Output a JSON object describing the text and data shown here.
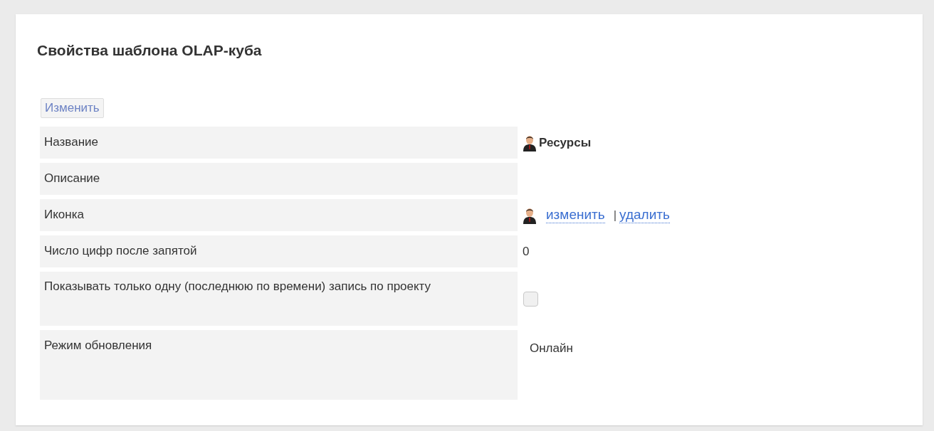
{
  "title": "Свойства шаблона OLAP-куба",
  "edit_button": "Изменить",
  "rows": [
    {
      "label": "Название",
      "kind": "icon_text",
      "value": "Ресурсы"
    },
    {
      "label": "Описание",
      "kind": "empty"
    },
    {
      "label": "Иконка",
      "kind": "icon_links",
      "links": [
        "изменить",
        "удалить"
      ],
      "separator": "|"
    },
    {
      "label": "Число цифр после запятой",
      "kind": "text",
      "value": "0"
    },
    {
      "label": "Показывать только одну (последнюю по времени) запись по проекту",
      "kind": "checkbox",
      "checked": false
    },
    {
      "label": "Режим обновления",
      "kind": "text_tall",
      "value": "Онлайн"
    }
  ]
}
